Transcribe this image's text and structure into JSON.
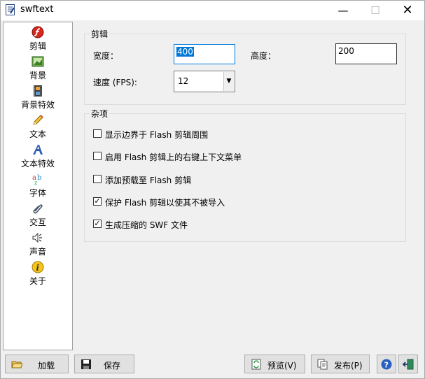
{
  "window": {
    "title": "swftext"
  },
  "title_controls": {
    "minimize": "—",
    "maximize": "☐",
    "close": "✕"
  },
  "sidebar": {
    "items": [
      {
        "label": "剪辑",
        "icon": "flash-icon",
        "selected": true
      },
      {
        "label": "背景",
        "icon": "picture-icon"
      },
      {
        "label": "背景特效",
        "icon": "film-icon"
      },
      {
        "label": "文本",
        "icon": "pencil-icon"
      },
      {
        "label": "文本特效",
        "icon": "text-effect-icon"
      },
      {
        "label": "字体",
        "icon": "font-icon"
      },
      {
        "label": "交互",
        "icon": "paperclip-icon"
      },
      {
        "label": "声音",
        "icon": "speaker-icon"
      },
      {
        "label": "关于",
        "icon": "info-icon"
      }
    ]
  },
  "clip_group": {
    "title": "剪辑",
    "width_label": "宽度：",
    "width_value": "400",
    "height_label": "高度：",
    "height_value": "200",
    "fps_label": "速度 (FPS):",
    "fps_value": "12"
  },
  "misc_group": {
    "title": "杂项",
    "options": [
      {
        "label": "显示边界于 Flash 剪辑周围",
        "checked": false
      },
      {
        "label": "启用 Flash 剪辑上的右键上下文菜单",
        "checked": false
      },
      {
        "label": "添加预载至 Flash 剪辑",
        "checked": false
      },
      {
        "label": "保护 Flash 剪辑以使其不被导入",
        "checked": true
      },
      {
        "label": "生成压缩的 SWF 文件",
        "checked": true
      }
    ]
  },
  "buttons": {
    "load": "加载",
    "save": "保存",
    "preview": "预览(V)",
    "publish": "发布(P)"
  },
  "colors": {
    "accent": "#0078d7",
    "flash_red": "#d8261e"
  }
}
